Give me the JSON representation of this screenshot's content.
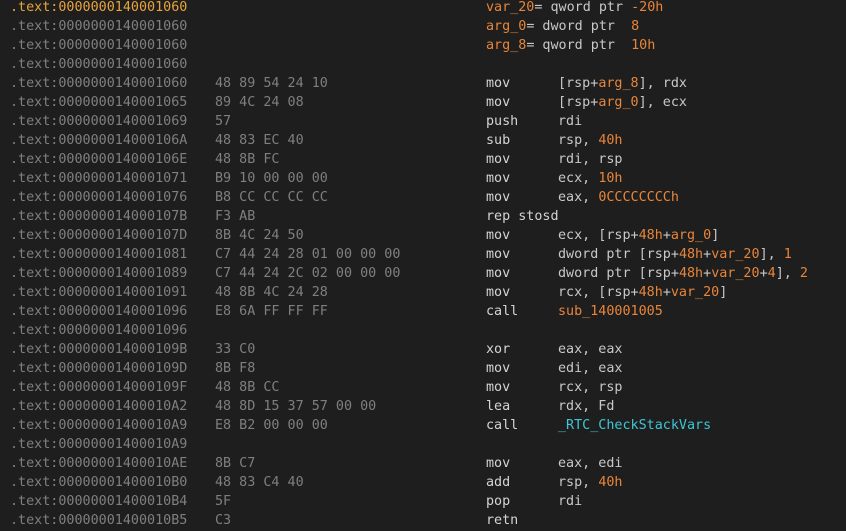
{
  "colors": {
    "background": "#1e1e1e",
    "address": "#7f7f7f",
    "current_address": "#e8a33a",
    "bytes": "#7f7f7f",
    "mnemonic": "#d4d4d4",
    "operand": "#c8c8c8",
    "variable": "#e8853a",
    "number": "#e8853a",
    "function": "#3ec6d4"
  },
  "rows": [
    {
      "address": ".text:0000000140001060",
      "bytes": "",
      "current": true,
      "decl": [
        {
          "t": "var_20",
          "k": "var"
        },
        {
          "t": "= qword ptr ",
          "k": "plain"
        },
        {
          "t": "-20h",
          "k": "num"
        }
      ]
    },
    {
      "address": ".text:0000000140001060",
      "bytes": "",
      "decl": [
        {
          "t": "arg_0",
          "k": "var"
        },
        {
          "t": "= dword ptr  ",
          "k": "plain"
        },
        {
          "t": "8",
          "k": "num"
        }
      ]
    },
    {
      "address": ".text:0000000140001060",
      "bytes": "",
      "decl": [
        {
          "t": "arg_8",
          "k": "var"
        },
        {
          "t": "= qword ptr  ",
          "k": "plain"
        },
        {
          "t": "10h",
          "k": "num"
        }
      ]
    },
    {
      "address": ".text:0000000140001060",
      "bytes": ""
    },
    {
      "address": ".text:0000000140001060",
      "bytes": "48 89 54 24 10",
      "mnemonic": "mov",
      "operands": [
        {
          "t": "[rsp+",
          "k": "plain"
        },
        {
          "t": "arg_8",
          "k": "var"
        },
        {
          "t": "], rdx",
          "k": "plain"
        }
      ]
    },
    {
      "address": ".text:0000000140001065",
      "bytes": "89 4C 24 08",
      "mnemonic": "mov",
      "operands": [
        {
          "t": "[rsp+",
          "k": "plain"
        },
        {
          "t": "arg_0",
          "k": "var"
        },
        {
          "t": "], ecx",
          "k": "plain"
        }
      ]
    },
    {
      "address": ".text:0000000140001069",
      "bytes": "57",
      "mnemonic": "push",
      "operands": [
        {
          "t": "rdi",
          "k": "plain"
        }
      ]
    },
    {
      "address": ".text:000000014000106A",
      "bytes": "48 83 EC 40",
      "mnemonic": "sub",
      "operands": [
        {
          "t": "rsp, ",
          "k": "plain"
        },
        {
          "t": "40h",
          "k": "num"
        }
      ]
    },
    {
      "address": ".text:000000014000106E",
      "bytes": "48 8B FC",
      "mnemonic": "mov",
      "operands": [
        {
          "t": "rdi, rsp",
          "k": "plain"
        }
      ]
    },
    {
      "address": ".text:0000000140001071",
      "bytes": "B9 10 00 00 00",
      "mnemonic": "mov",
      "operands": [
        {
          "t": "ecx, ",
          "k": "plain"
        },
        {
          "t": "10h",
          "k": "num"
        }
      ]
    },
    {
      "address": ".text:0000000140001076",
      "bytes": "B8 CC CC CC CC",
      "mnemonic": "mov",
      "operands": [
        {
          "t": "eax, ",
          "k": "plain"
        },
        {
          "t": "0CCCCCCCCh",
          "k": "num"
        }
      ]
    },
    {
      "address": ".text:000000014000107B",
      "bytes": "F3 AB",
      "mnemonic": "rep stosd",
      "operands": []
    },
    {
      "address": ".text:000000014000107D",
      "bytes": "8B 4C 24 50",
      "mnemonic": "mov",
      "operands": [
        {
          "t": "ecx, [rsp+",
          "k": "plain"
        },
        {
          "t": "48h",
          "k": "num"
        },
        {
          "t": "+",
          "k": "plain"
        },
        {
          "t": "arg_0",
          "k": "var"
        },
        {
          "t": "]",
          "k": "plain"
        }
      ]
    },
    {
      "address": ".text:0000000140001081",
      "bytes": "C7 44 24 28 01 00 00 00",
      "mnemonic": "mov",
      "operands": [
        {
          "t": "dword ptr [rsp+",
          "k": "plain"
        },
        {
          "t": "48h",
          "k": "num"
        },
        {
          "t": "+",
          "k": "plain"
        },
        {
          "t": "var_20",
          "k": "var"
        },
        {
          "t": "], ",
          "k": "plain"
        },
        {
          "t": "1",
          "k": "num"
        }
      ]
    },
    {
      "address": ".text:0000000140001089",
      "bytes": "C7 44 24 2C 02 00 00 00",
      "mnemonic": "mov",
      "operands": [
        {
          "t": "dword ptr [rsp+",
          "k": "plain"
        },
        {
          "t": "48h",
          "k": "num"
        },
        {
          "t": "+",
          "k": "plain"
        },
        {
          "t": "var_20",
          "k": "var"
        },
        {
          "t": "+",
          "k": "plain"
        },
        {
          "t": "4",
          "k": "num"
        },
        {
          "t": "], ",
          "k": "plain"
        },
        {
          "t": "2",
          "k": "num"
        }
      ]
    },
    {
      "address": ".text:0000000140001091",
      "bytes": "48 8B 4C 24 28",
      "mnemonic": "mov",
      "operands": [
        {
          "t": "rcx, [rsp+",
          "k": "plain"
        },
        {
          "t": "48h",
          "k": "num"
        },
        {
          "t": "+",
          "k": "plain"
        },
        {
          "t": "var_20",
          "k": "var"
        },
        {
          "t": "]",
          "k": "plain"
        }
      ]
    },
    {
      "address": ".text:0000000140001096",
      "bytes": "E8 6A FF FF FF",
      "mnemonic": "call",
      "operands": [
        {
          "t": "sub_140001005",
          "k": "sym"
        }
      ]
    },
    {
      "address": ".text:0000000140001096",
      "bytes": ""
    },
    {
      "address": ".text:000000014000109B",
      "bytes": "33 C0",
      "mnemonic": "xor",
      "operands": [
        {
          "t": "eax, eax",
          "k": "plain"
        }
      ]
    },
    {
      "address": ".text:000000014000109D",
      "bytes": "8B F8",
      "mnemonic": "mov",
      "operands": [
        {
          "t": "edi, eax",
          "k": "plain"
        }
      ]
    },
    {
      "address": ".text:000000014000109F",
      "bytes": "48 8B CC",
      "mnemonic": "mov",
      "operands": [
        {
          "t": "rcx, rsp",
          "k": "plain"
        }
      ]
    },
    {
      "address": ".text:00000001400010A2",
      "bytes": "48 8D 15 37 57 00 00",
      "mnemonic": "lea",
      "operands": [
        {
          "t": "rdx, Fd",
          "k": "plain"
        }
      ]
    },
    {
      "address": ".text:00000001400010A9",
      "bytes": "E8 B2 00 00 00",
      "mnemonic": "call",
      "operands": [
        {
          "t": "_RTC_CheckStackVars",
          "k": "func"
        }
      ]
    },
    {
      "address": ".text:00000001400010A9",
      "bytes": ""
    },
    {
      "address": ".text:00000001400010AE",
      "bytes": "8B C7",
      "mnemonic": "mov",
      "operands": [
        {
          "t": "eax, edi",
          "k": "plain"
        }
      ]
    },
    {
      "address": ".text:00000001400010B0",
      "bytes": "48 83 C4 40",
      "mnemonic": "add",
      "operands": [
        {
          "t": "rsp, ",
          "k": "plain"
        },
        {
          "t": "40h",
          "k": "num"
        }
      ]
    },
    {
      "address": ".text:00000001400010B4",
      "bytes": "5F",
      "mnemonic": "pop",
      "operands": [
        {
          "t": "rdi",
          "k": "plain"
        }
      ]
    },
    {
      "address": ".text:00000001400010B5",
      "bytes": "C3",
      "mnemonic": "retn",
      "operands": []
    }
  ]
}
